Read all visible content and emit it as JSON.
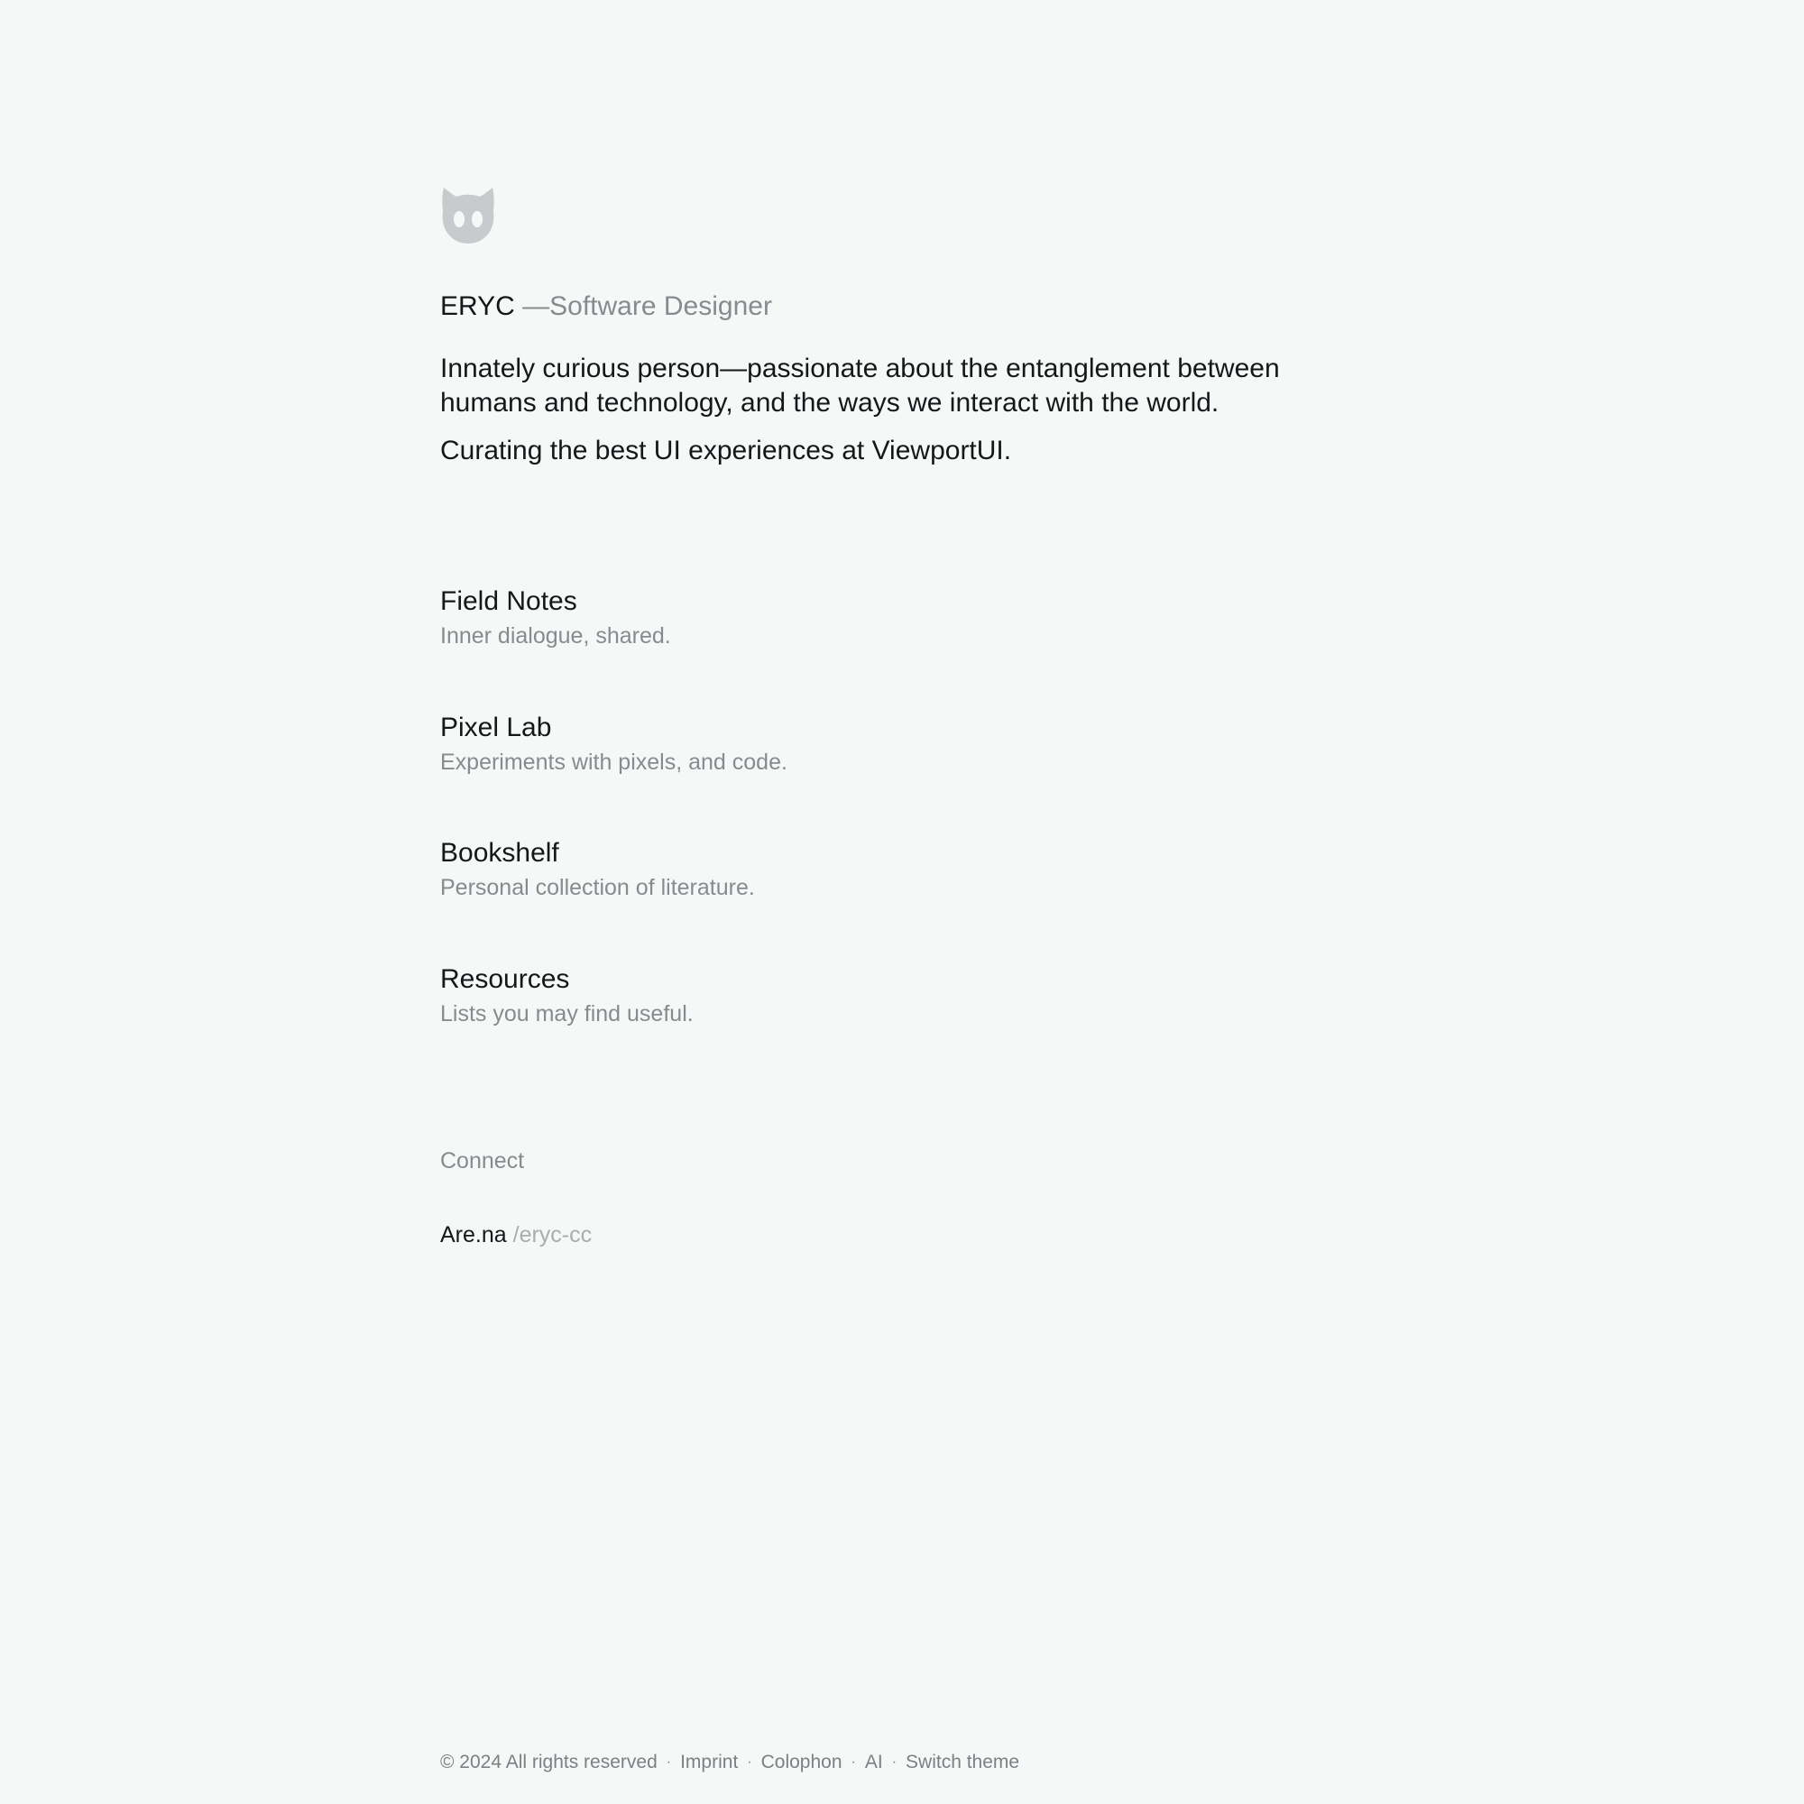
{
  "header": {
    "logo_icon": "cat-head-icon",
    "name": "ERYC",
    "role": " —Software Designer"
  },
  "intro": {
    "paragraph1": "Innately curious person—passionate about the entanglement between humans and technology, and the ways we interact with the world.",
    "paragraph2": "Curating the best UI experiences at ViewportUI."
  },
  "sections": [
    {
      "title": "Field Notes",
      "description": "Inner dialogue, shared."
    },
    {
      "title": "Pixel Lab",
      "description": "Experiments with pixels, and code."
    },
    {
      "title": "Bookshelf",
      "description": "Personal collection of literature."
    },
    {
      "title": "Resources",
      "description": "Lists you may find useful."
    }
  ],
  "connect": {
    "label": "Connect",
    "links": [
      {
        "service": "Are.na",
        "handle": " /eryc-cc"
      }
    ]
  },
  "footer": {
    "copyright": "© 2024 All rights reserved",
    "separator": "·",
    "links": [
      "Imprint",
      "Colophon",
      "AI",
      "Switch theme"
    ]
  },
  "colors": {
    "background": "#f6f8f7",
    "text_primary": "#15171a",
    "text_secondary": "#868b8f",
    "text_tertiary": "#a9adb0",
    "logo": "#c8cbce"
  }
}
